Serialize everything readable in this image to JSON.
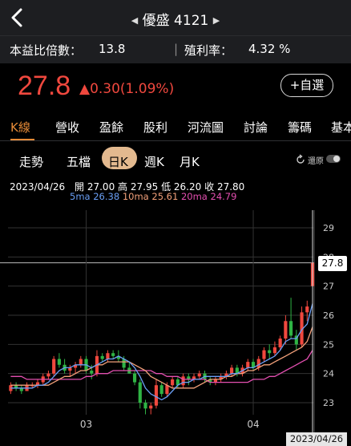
{
  "nav": {
    "title": "優盛 4121",
    "prev_arrow": "◀",
    "next_arrow": "▶"
  },
  "metrics": {
    "pe_label": "本益比倍數：",
    "pe_value": "13.8",
    "yield_label": "殖利率：",
    "yield_value": "4.32 %"
  },
  "quote": {
    "price": "27.8",
    "change": "▲0.30(1.09%)",
    "add_watchlist": "+自選"
  },
  "tabs": [
    "K線",
    "營收",
    "盈餘",
    "股利",
    "河流圖",
    "討論",
    "籌碼",
    "基本"
  ],
  "periods": [
    "走勢",
    "五檔",
    "日K",
    "週K",
    "月K"
  ],
  "active_period": "日K",
  "restore_label": "還原",
  "ohlc": {
    "date": "2023/04/26",
    "open_label": "開",
    "open": "27.00",
    "high_label": "高",
    "high": "27.95",
    "low_label": "低",
    "low": "26.20",
    "close_label": "收",
    "close": "27.80"
  },
  "ma": {
    "ma5_label": "5ma",
    "ma5": "26.38",
    "ma10_label": "10ma",
    "ma10": "25.61",
    "ma20_label": "20ma",
    "ma20": "24.79"
  },
  "colors": {
    "up": "#f0483e",
    "down": "#2fb344",
    "ma5": "#6a9ff5",
    "ma10": "#f2a07a",
    "ma20": "#e34fb0",
    "accent": "#e58a37"
  },
  "chart_data": {
    "type": "candlestick",
    "y_ticks": [
      "29",
      "28",
      "27",
      "26",
      "25",
      "24",
      "23"
    ],
    "ylim": [
      22.6,
      29.4
    ],
    "x_labels": [
      "03",
      "04"
    ],
    "last_price_tag": "27.8",
    "date_tag": "2023/04/26",
    "candles": [
      [
        23.4,
        23.7,
        23.3,
        23.6
      ],
      [
        23.6,
        23.7,
        23.4,
        23.5
      ],
      [
        23.5,
        23.6,
        23.3,
        23.4
      ],
      [
        23.4,
        23.7,
        23.4,
        23.6
      ],
      [
        23.6,
        23.7,
        23.5,
        23.6
      ],
      [
        23.6,
        23.8,
        23.5,
        23.7
      ],
      [
        23.7,
        24.0,
        23.6,
        23.9
      ],
      [
        23.9,
        24.1,
        23.8,
        24.0
      ],
      [
        24.0,
        24.6,
        23.9,
        24.5
      ],
      [
        24.5,
        24.7,
        24.2,
        24.3
      ],
      [
        24.3,
        24.5,
        24.0,
        24.1
      ],
      [
        24.1,
        24.3,
        23.9,
        24.2
      ],
      [
        24.2,
        24.4,
        24.0,
        24.3
      ],
      [
        24.3,
        24.6,
        24.2,
        24.5
      ],
      [
        24.5,
        24.6,
        24.0,
        24.1
      ],
      [
        24.1,
        24.3,
        23.8,
        24.0
      ],
      [
        24.0,
        24.8,
        23.9,
        24.6
      ],
      [
        24.6,
        24.7,
        24.4,
        24.5
      ],
      [
        24.5,
        24.8,
        24.4,
        24.7
      ],
      [
        24.7,
        24.8,
        24.5,
        24.6
      ],
      [
        24.6,
        24.8,
        24.4,
        24.5
      ],
      [
        24.5,
        24.6,
        24.1,
        24.2
      ],
      [
        24.2,
        24.4,
        24.0,
        24.0
      ],
      [
        24.0,
        24.1,
        23.6,
        23.7
      ],
      [
        23.7,
        23.8,
        22.8,
        23.0
      ],
      [
        23.0,
        23.1,
        22.6,
        22.8
      ],
      [
        22.8,
        23.0,
        22.6,
        22.9
      ],
      [
        22.9,
        23.8,
        22.8,
        23.6
      ],
      [
        23.6,
        23.7,
        23.2,
        23.3
      ],
      [
        23.3,
        23.7,
        23.2,
        23.6
      ],
      [
        23.6,
        23.9,
        23.5,
        23.8
      ],
      [
        23.8,
        23.9,
        23.5,
        23.6
      ],
      [
        23.6,
        24.0,
        23.5,
        23.9
      ],
      [
        23.9,
        24.0,
        23.6,
        23.8
      ],
      [
        23.8,
        24.0,
        23.7,
        23.9
      ],
      [
        23.9,
        24.1,
        23.8,
        24.0
      ],
      [
        24.0,
        24.1,
        23.7,
        23.8
      ],
      [
        23.8,
        23.9,
        23.6,
        23.7
      ],
      [
        23.7,
        23.9,
        23.6,
        23.8
      ],
      [
        23.8,
        24.0,
        23.7,
        23.9
      ],
      [
        23.9,
        24.1,
        23.8,
        24.0
      ],
      [
        24.0,
        24.3,
        23.9,
        24.2
      ],
      [
        24.2,
        24.3,
        23.9,
        24.0
      ],
      [
        24.0,
        24.3,
        23.9,
        24.2
      ],
      [
        24.2,
        24.5,
        24.1,
        24.4
      ],
      [
        24.4,
        24.5,
        24.1,
        24.2
      ],
      [
        24.2,
        24.6,
        24.1,
        24.5
      ],
      [
        24.5,
        24.9,
        24.4,
        24.8
      ],
      [
        24.8,
        25.0,
        24.5,
        24.7
      ],
      [
        24.7,
        25.1,
        24.6,
        24.9
      ],
      [
        24.9,
        25.3,
        24.8,
        25.2
      ],
      [
        25.2,
        26.0,
        25.0,
        25.8
      ],
      [
        25.8,
        26.6,
        25.2,
        25.3
      ],
      [
        25.3,
        25.5,
        24.8,
        25.0
      ],
      [
        25.0,
        26.3,
        24.9,
        26.1
      ],
      [
        26.1,
        26.5,
        25.8,
        26.3
      ],
      [
        27.0,
        27.95,
        26.2,
        27.8
      ]
    ],
    "ma5_values": [
      23.5,
      23.5,
      23.5,
      23.5,
      23.5,
      23.6,
      23.6,
      23.7,
      23.9,
      24.1,
      24.2,
      24.2,
      24.3,
      24.3,
      24.3,
      24.2,
      24.3,
      24.4,
      24.5,
      24.5,
      24.6,
      24.5,
      24.4,
      24.2,
      23.9,
      23.5,
      23.3,
      23.2,
      23.1,
      23.2,
      23.4,
      23.6,
      23.7,
      23.7,
      23.8,
      23.8,
      23.9,
      23.9,
      23.9,
      23.9,
      23.9,
      24.0,
      24.0,
      24.1,
      24.2,
      24.2,
      24.3,
      24.4,
      24.5,
      24.6,
      24.8,
      25.1,
      25.2,
      25.2,
      25.5,
      25.7,
      26.4
    ],
    "ma10_values": [
      23.6,
      23.6,
      23.6,
      23.6,
      23.6,
      23.6,
      23.6,
      23.6,
      23.7,
      23.8,
      23.9,
      23.9,
      24.0,
      24.1,
      24.1,
      24.2,
      24.3,
      24.3,
      24.4,
      24.4,
      24.4,
      24.4,
      24.4,
      24.3,
      24.2,
      24.1,
      23.9,
      23.8,
      23.7,
      23.6,
      23.5,
      23.5,
      23.5,
      23.5,
      23.5,
      23.6,
      23.7,
      23.8,
      23.8,
      23.8,
      23.9,
      23.9,
      24.0,
      24.0,
      24.1,
      24.1,
      24.2,
      24.3,
      24.3,
      24.4,
      24.5,
      24.6,
      24.7,
      24.8,
      24.9,
      25.1,
      25.6
    ],
    "ma20_values": [
      23.9,
      23.9,
      23.9,
      23.8,
      23.8,
      23.8,
      23.8,
      23.8,
      23.8,
      23.8,
      23.8,
      23.8,
      23.8,
      23.8,
      23.9,
      23.9,
      24.0,
      24.0,
      24.0,
      24.1,
      24.1,
      24.1,
      24.1,
      24.1,
      24.1,
      24.1,
      24.1,
      24.0,
      24.0,
      23.9,
      23.9,
      23.9,
      23.8,
      23.8,
      23.8,
      23.8,
      23.8,
      23.7,
      23.7,
      23.7,
      23.7,
      23.7,
      23.7,
      23.7,
      23.7,
      23.8,
      23.8,
      23.8,
      23.9,
      23.9,
      24.0,
      24.1,
      24.2,
      24.3,
      24.4,
      24.5,
      24.8
    ]
  }
}
